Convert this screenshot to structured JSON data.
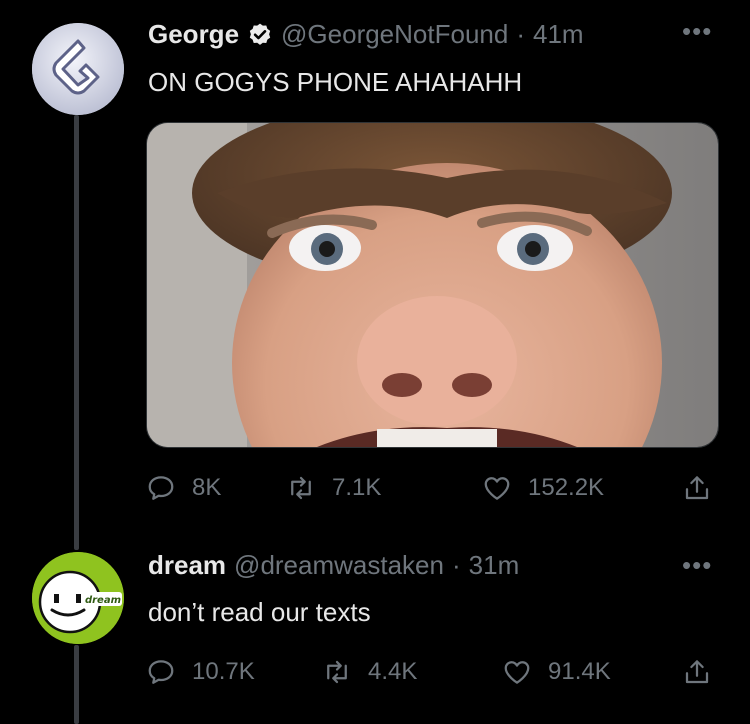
{
  "tweet": {
    "author_name": "George",
    "handle": "@GeorgeNotFound",
    "time": "41m",
    "text": "ON GOGYS PHONE AHAHAHH",
    "counts": {
      "replies": "8K",
      "retweets": "7.1K",
      "likes": "152.2K"
    }
  },
  "reply": {
    "author_name": "dream",
    "handle": "@dreamwastaken",
    "time": "31m",
    "text": "don’t read our texts",
    "avatar_label": "dream",
    "counts": {
      "replies": "10.7K",
      "retweets": "4.4K",
      "likes": "91.4K"
    }
  },
  "colors": {
    "background": "#000000",
    "muted_text": "#6f767d",
    "thread_line": "#3a3d42",
    "dream_green": "#8fc31f"
  }
}
